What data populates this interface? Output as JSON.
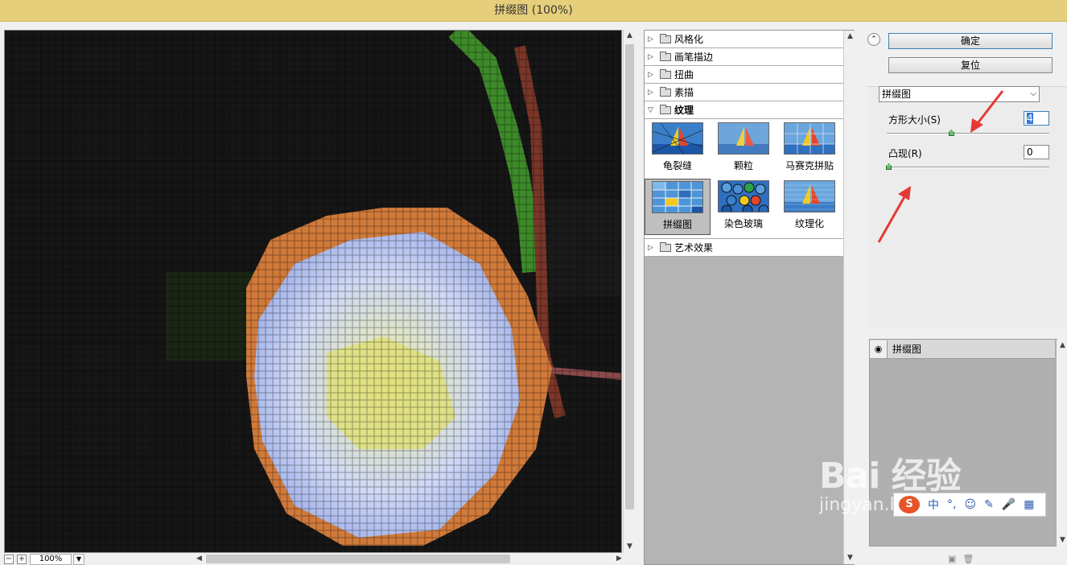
{
  "window": {
    "title": "拼缀图 (100%)"
  },
  "preview": {
    "zoom": "100%",
    "zoom_out": "−",
    "zoom_in": "+"
  },
  "gallery": {
    "categories": [
      {
        "label": "风格化",
        "expanded": false
      },
      {
        "label": "画笔描边",
        "expanded": false
      },
      {
        "label": "扭曲",
        "expanded": false
      },
      {
        "label": "素描",
        "expanded": false
      },
      {
        "label": "纹理",
        "expanded": true
      },
      {
        "label": "艺术效果",
        "expanded": false
      }
    ],
    "texture_filters": [
      {
        "label": "龟裂缝"
      },
      {
        "label": "颗粒"
      },
      {
        "label": "马赛克拼贴"
      },
      {
        "label": "拼缀图",
        "selected": true
      },
      {
        "label": "染色玻璃"
      },
      {
        "label": "纹理化"
      }
    ]
  },
  "panel": {
    "ok_label": "确定",
    "reset_label": "复位",
    "filter_select": "拼缀图",
    "square_size_label": "方形大小(S)",
    "square_size_value": "4",
    "relief_label": "凸现(R)",
    "relief_value": "0",
    "square_size_fraction": 0.4,
    "relief_fraction": 0.0
  },
  "layers": {
    "items": [
      {
        "name": "拼缀图"
      }
    ]
  },
  "watermark": {
    "logo": "Bai 经验",
    "sub": "jingyan.baidu.com"
  },
  "ime": {
    "lang": "中"
  },
  "colors": {
    "titlebar": "#e6cf7a",
    "accent": "#3c7fb1",
    "annotation": "#e53935"
  }
}
